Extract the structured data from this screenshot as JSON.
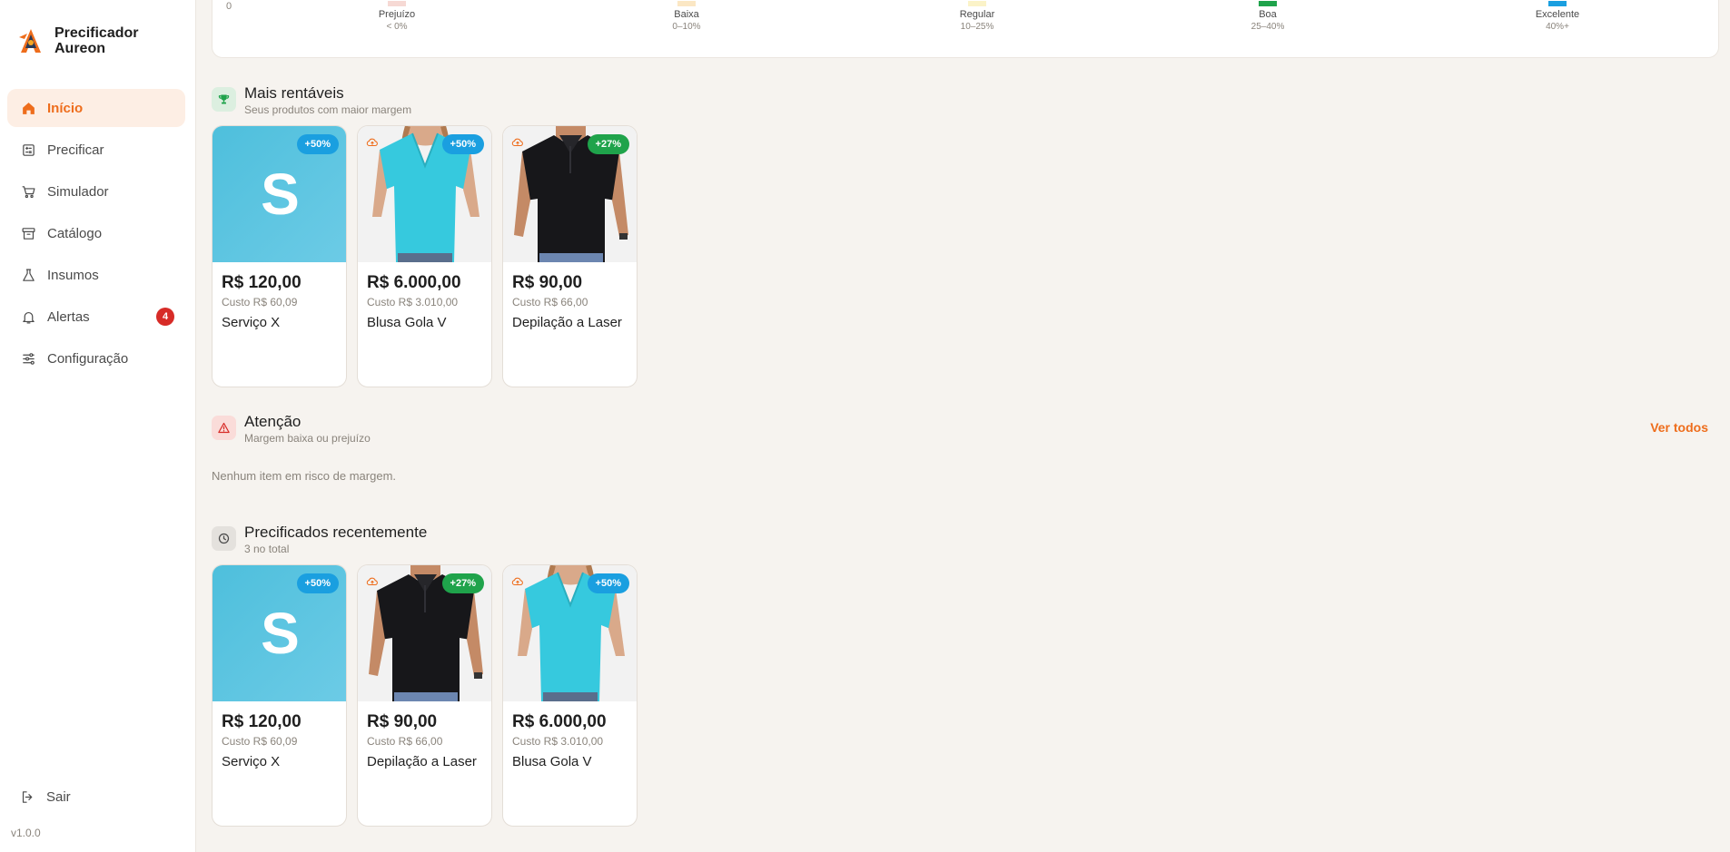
{
  "sidebar": {
    "brand": "Precificador Aureon",
    "nav": [
      {
        "label": "Início",
        "icon": "home-icon"
      },
      {
        "label": "Precificar",
        "icon": "calculator-icon"
      },
      {
        "label": "Simulador",
        "icon": "cart-icon"
      },
      {
        "label": "Catálogo",
        "icon": "archive-icon"
      },
      {
        "label": "Insumos",
        "icon": "flask-icon"
      },
      {
        "label": "Alertas",
        "icon": "bell-icon",
        "badge": "4"
      },
      {
        "label": "Configuração",
        "icon": "sliders-icon"
      }
    ],
    "logout": "Sair",
    "version": "v1.0.0"
  },
  "scale": {
    "zero": "0",
    "items": [
      {
        "label": "Prejuízo",
        "range": "< 0%",
        "color": "#f6d9d4"
      },
      {
        "label": "Baixa",
        "range": "0–10%",
        "color": "#fbe7c4"
      },
      {
        "label": "Regular",
        "range": "10–25%",
        "color": "#fbf3c8"
      },
      {
        "label": "Boa",
        "range": "25–40%",
        "color": "#1fa34b"
      },
      {
        "label": "Excelente",
        "range": "40%+",
        "color": "#1a9fe0"
      }
    ]
  },
  "top": {
    "title": "Mais rentáveis",
    "subtitle": "Seus produtos com maior margem",
    "cards": [
      {
        "price": "R$ 120,00",
        "cost": "Custo R$ 60,09",
        "name": "Serviço X",
        "margin": "+50%",
        "margin_color": "#1a9fe0",
        "image": "letter",
        "letter": "S"
      },
      {
        "price": "R$ 6.000,00",
        "cost": "Custo R$ 3.010,00",
        "name": "Blusa Gola V",
        "margin": "+50%",
        "margin_color": "#1a9fe0",
        "image": "blouse"
      },
      {
        "price": "R$ 90,00",
        "cost": "Custo R$ 66,00",
        "name": "Depilação a Laser",
        "margin": "+27%",
        "margin_color": "#1fa34b",
        "image": "polo"
      }
    ]
  },
  "attention": {
    "title": "Atenção",
    "subtitle": "Margem baixa ou prejuízo",
    "link": "Ver todos",
    "empty": "Nenhum item em risco de margem."
  },
  "recent": {
    "title": "Precificados recentemente",
    "subtitle": "3 no total",
    "cards": [
      {
        "price": "R$ 120,00",
        "cost": "Custo R$ 60,09",
        "name": "Serviço X",
        "margin": "+50%",
        "margin_color": "#1a9fe0",
        "image": "letter",
        "letter": "S"
      },
      {
        "price": "R$ 90,00",
        "cost": "Custo R$ 66,00",
        "name": "Depilação a Laser",
        "margin": "+27%",
        "margin_color": "#1fa34b",
        "image": "polo"
      },
      {
        "price": "R$ 6.000,00",
        "cost": "Custo R$ 3.010,00",
        "name": "Blusa Gola V",
        "margin": "+50%",
        "margin_color": "#1a9fe0",
        "image": "blouse"
      }
    ]
  }
}
